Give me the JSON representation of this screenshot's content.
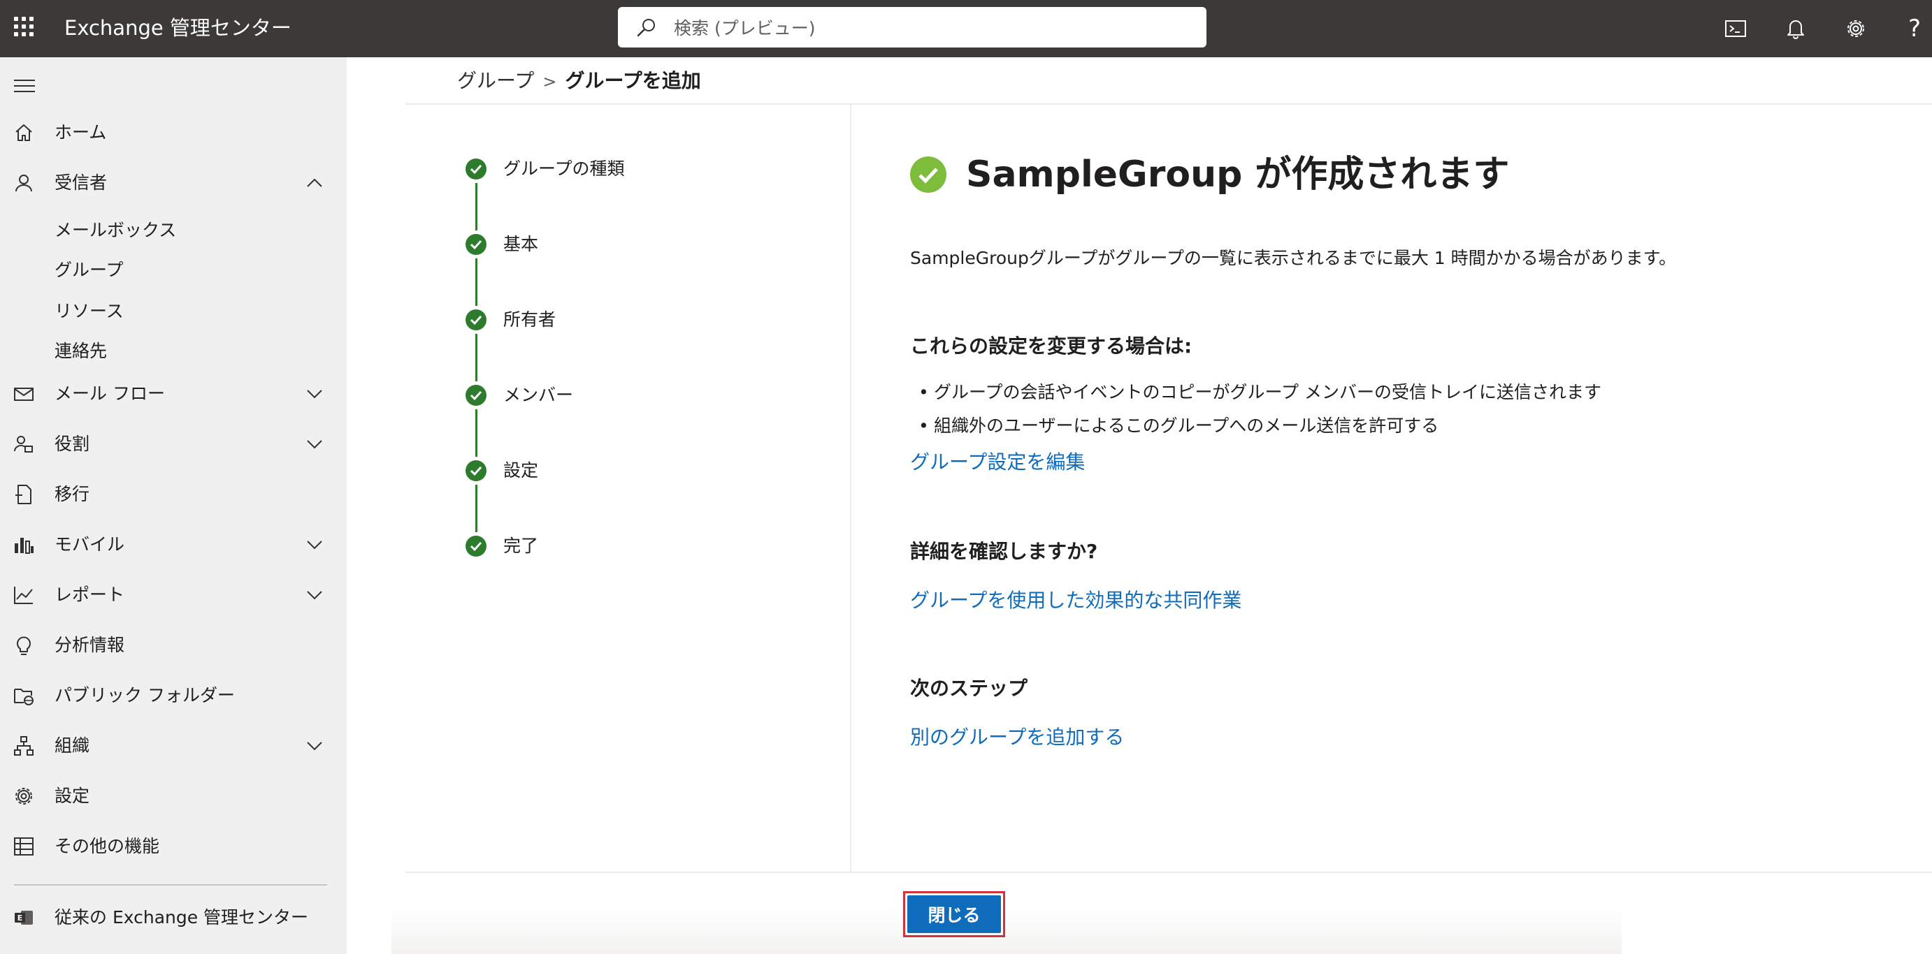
{
  "topbar": {
    "app_title": "Exchange 管理センター",
    "search_placeholder": "検索 (プレビュー)",
    "help_label": "?"
  },
  "sidebar": {
    "items": [
      {
        "label": "ホーム",
        "icon": "home-icon"
      },
      {
        "label": "受信者",
        "icon": "person-icon",
        "expanded": true
      },
      {
        "label": "メール フロー",
        "icon": "mail-icon"
      },
      {
        "label": "役割",
        "icon": "role-icon"
      },
      {
        "label": "移行",
        "icon": "migration-icon"
      },
      {
        "label": "モバイル",
        "icon": "mobile-icon"
      },
      {
        "label": "レポート",
        "icon": "report-icon"
      },
      {
        "label": "分析情報",
        "icon": "lightbulb-icon"
      },
      {
        "label": "パブリック フォルダー",
        "icon": "public-folder-icon"
      },
      {
        "label": "組織",
        "icon": "organization-icon"
      },
      {
        "label": "設定",
        "icon": "gear-icon"
      },
      {
        "label": "その他の機能",
        "icon": "table-icon"
      }
    ],
    "recipients_subitems": [
      "メールボックス",
      "グループ",
      "リソース",
      "連絡先"
    ],
    "classic_link": "従来の Exchange 管理センター"
  },
  "breadcrumb": {
    "parent": "グループ",
    "current": "グループを追加"
  },
  "steps": [
    {
      "label": "グループの種類",
      "status": "complete"
    },
    {
      "label": "基本",
      "status": "complete"
    },
    {
      "label": "所有者",
      "status": "complete"
    },
    {
      "label": "メンバー",
      "status": "complete"
    },
    {
      "label": "設定",
      "status": "complete"
    },
    {
      "label": "完了",
      "status": "complete"
    }
  ],
  "content": {
    "title": "SampleGroup が作成されます",
    "notice": "SampleGroupグループがグループの一覧に表示されるまでに最大 1 時間かかる場合があります。",
    "change_heading": "これらの設定を変更する場合は:",
    "change_bullets": [
      "グループの会話やイベントのコピーがグループ メンバーの受信トレイに送信されます",
      "組織外のユーザーによるこのグループへのメール送信を許可する"
    ],
    "edit_link": "グループ設定を編集",
    "learn_heading": "詳細を確認しますか?",
    "learn_link": "グループを使用した効果的な共同作業",
    "next_heading": "次のステップ",
    "next_link": "別のグループを追加する"
  },
  "footer": {
    "close_label": "閉じる"
  },
  "colors": {
    "topbar_bg": "#3b3a39",
    "sidebar_bg": "#f0f0f0",
    "step_complete": "#2d7b2d",
    "success_icon": "#7ebc3b",
    "link": "#0f6cbd",
    "primary_button": "#0f6cbd",
    "highlight_outline": "#d13438"
  }
}
